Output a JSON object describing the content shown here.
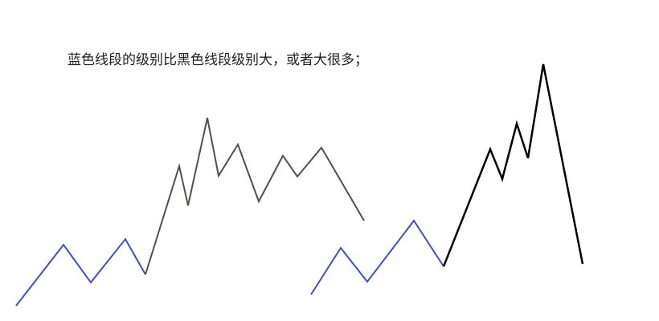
{
  "caption": "蓝色线段的级别比黑色线段级别大，或者大很多；",
  "colors": {
    "blue": "#3f4fbf",
    "dark_brown": "#5a4c4c",
    "black": "#000000",
    "text": "#222222",
    "background": "#ffffff"
  }
}
